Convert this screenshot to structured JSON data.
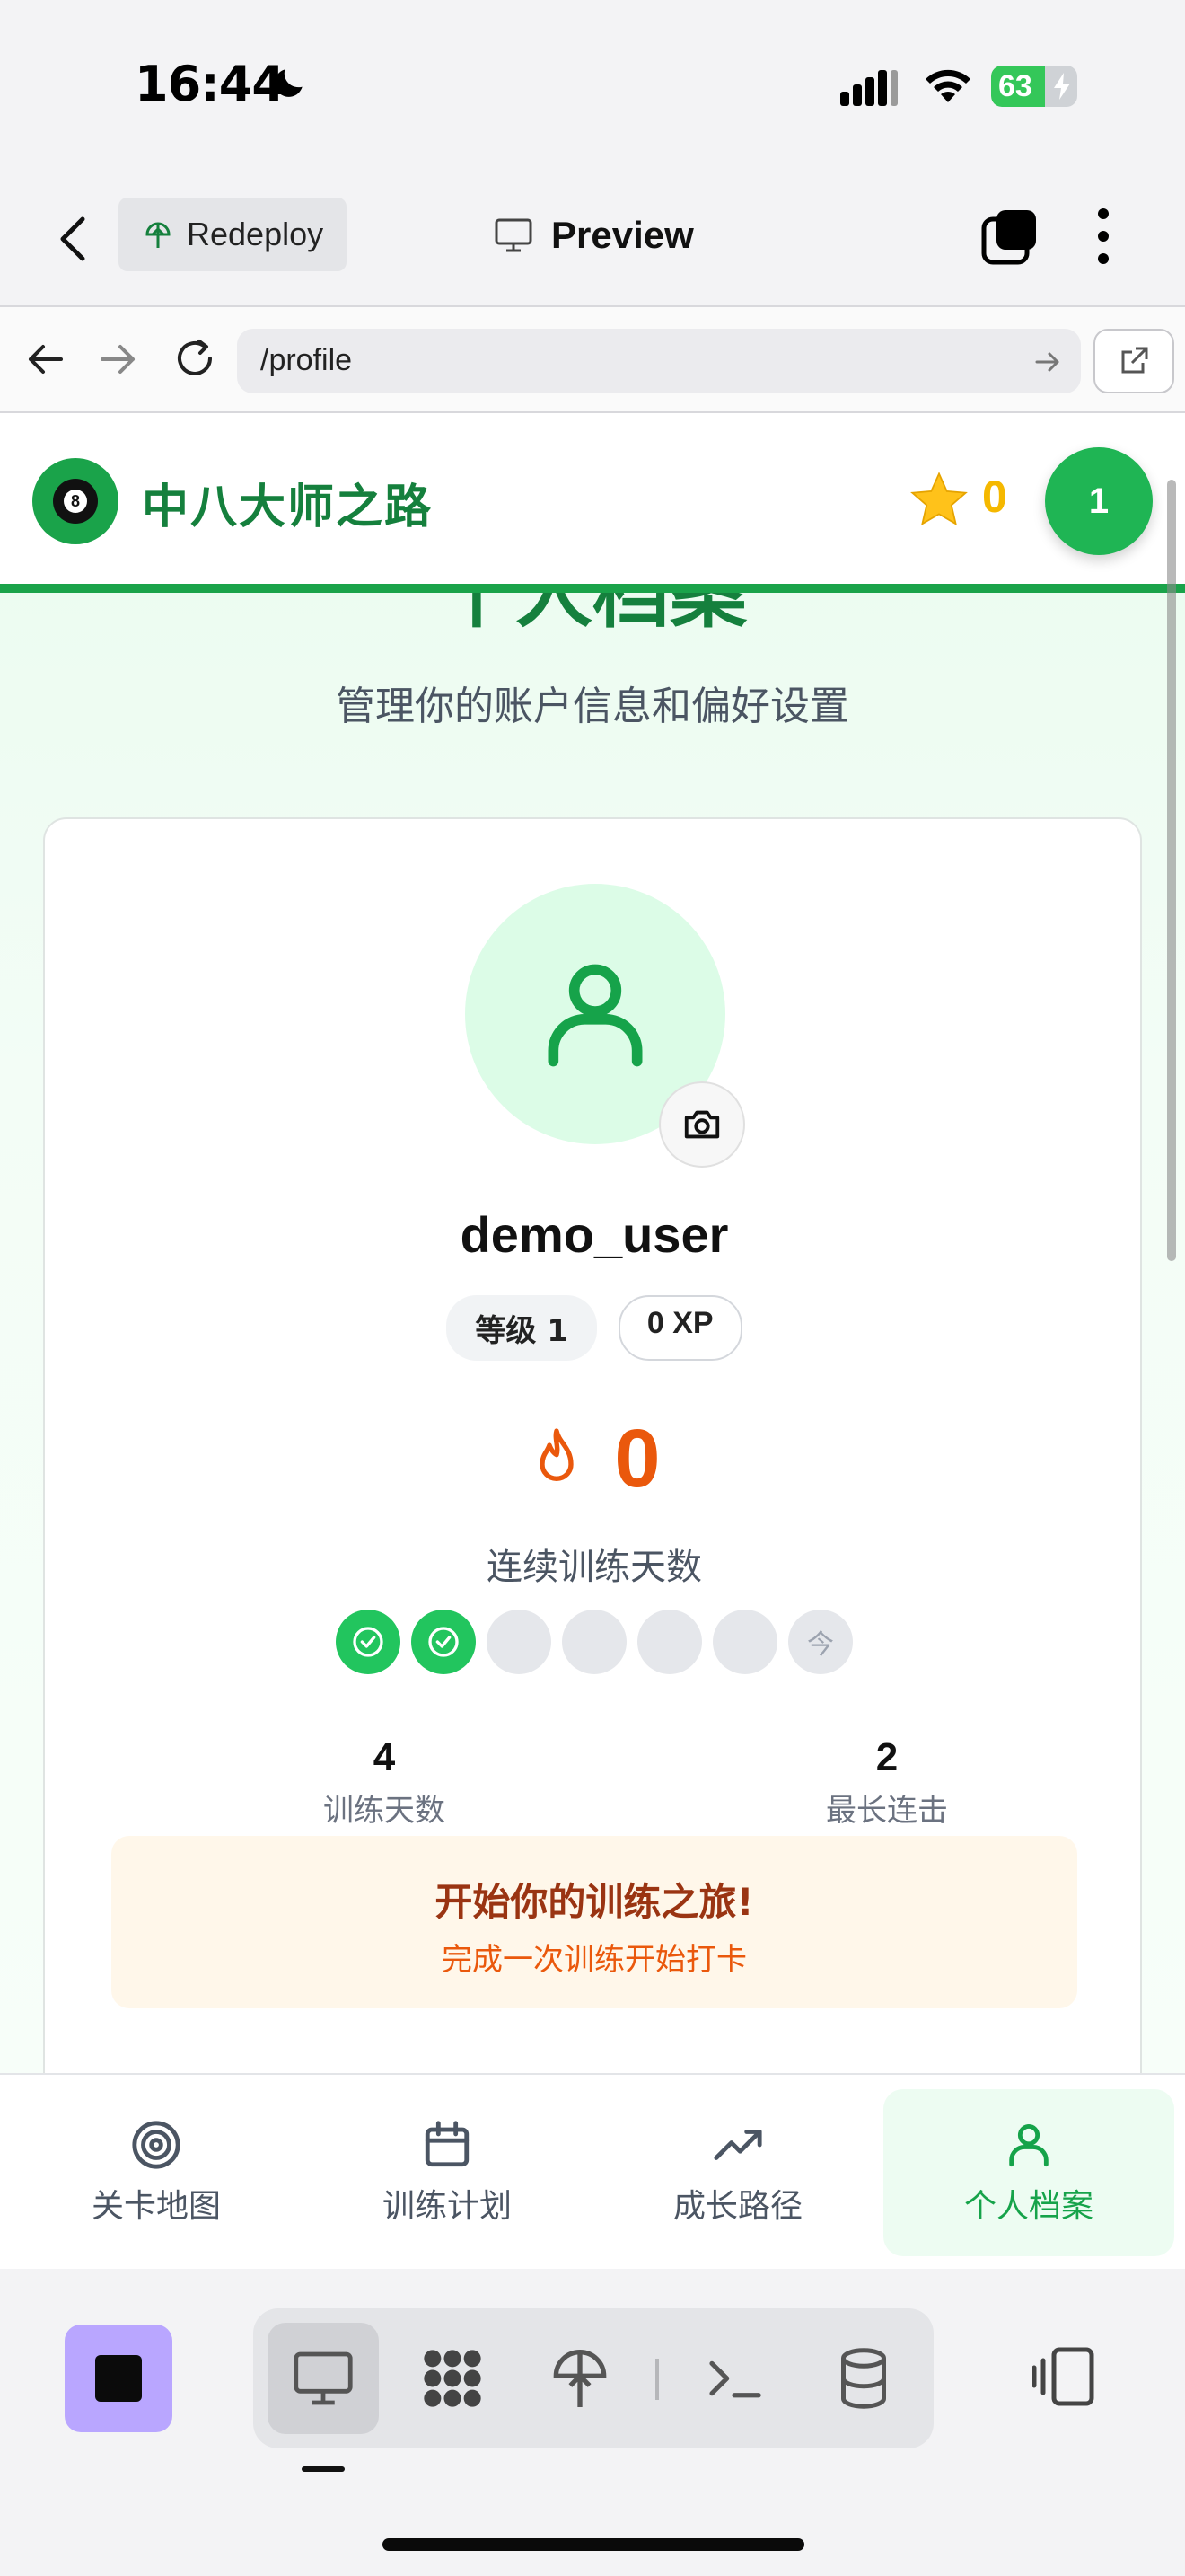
{
  "status_bar": {
    "time": "16:44",
    "battery_level": "63",
    "battery_fraction": 0.63
  },
  "app_bar": {
    "redeploy_label": "Redeploy",
    "preview_label": "Preview"
  },
  "browser": {
    "url": "/profile"
  },
  "site": {
    "title": "中八大师之路",
    "logo_ball_number": "8",
    "stars": "0",
    "level_badge": "1"
  },
  "page": {
    "heading": "个人档案",
    "subtitle": "管理你的账户信息和偏好设置"
  },
  "profile": {
    "username": "demo_user",
    "level_label": "等级 1",
    "xp_label": "0 XP",
    "streak_count": "0",
    "streak_label": "连续训练天数",
    "week_days": [
      {
        "state": "done"
      },
      {
        "state": "done"
      },
      {
        "state": "empty"
      },
      {
        "state": "empty"
      },
      {
        "state": "empty"
      },
      {
        "state": "empty"
      },
      {
        "state": "today",
        "label": "今"
      }
    ],
    "stats": [
      {
        "value": "4",
        "label": "训练天数"
      },
      {
        "value": "2",
        "label": "最长连击"
      }
    ],
    "cta_title": "开始你的训练之旅!",
    "cta_subtitle": "完成一次训练开始打卡"
  },
  "bottom_nav": [
    {
      "label": "关卡地图",
      "icon": "target-icon"
    },
    {
      "label": "训练计划",
      "icon": "calendar-icon"
    },
    {
      "label": "成长路径",
      "icon": "trending-up-icon"
    },
    {
      "label": "个人档案",
      "icon": "user-icon",
      "active": true
    }
  ],
  "colors": {
    "brand_green": "#15803d",
    "accent_green": "#22c55e",
    "streak_orange": "#ea580c",
    "star_yellow": "#f5b800",
    "stop_purple": "#b9a6ff"
  }
}
